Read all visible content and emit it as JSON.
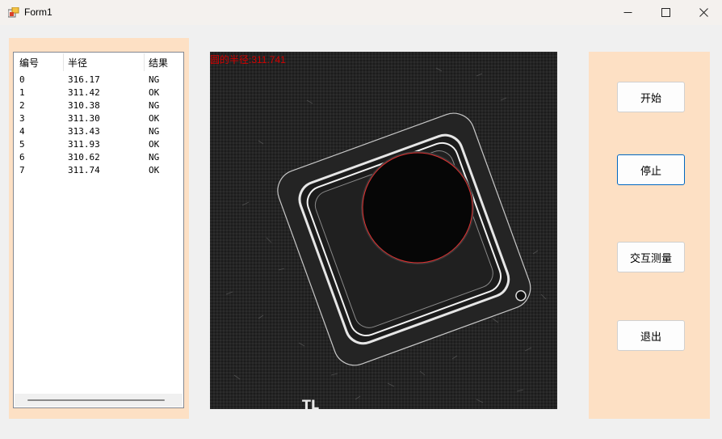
{
  "window": {
    "title": "Form1",
    "minimize_glyph": "—",
    "maximize_glyph": "☐",
    "close_glyph": "✕",
    "icon": "winforms-app-icon"
  },
  "results": {
    "columns": [
      "编号",
      "半径",
      "结果"
    ],
    "rows": [
      [
        "0",
        "316.17",
        "NG"
      ],
      [
        "1",
        "311.42",
        "OK"
      ],
      [
        "2",
        "310.38",
        "NG"
      ],
      [
        "3",
        "311.30",
        "OK"
      ],
      [
        "4",
        "313.43",
        "NG"
      ],
      [
        "5",
        "311.93",
        "OK"
      ],
      [
        "6",
        "310.62",
        "NG"
      ],
      [
        "7",
        "311.74",
        "OK"
      ]
    ]
  },
  "image": {
    "overlay_text": "圆的半径:311.741",
    "bottom_text": "TL",
    "overlay_color": "#d40000"
  },
  "buttons": {
    "start": "开始",
    "stop": "停止",
    "interactive_measure": "交互测量",
    "exit": "退出"
  },
  "colors": {
    "panel": "#fde0c4",
    "focus": "#0067c0"
  }
}
